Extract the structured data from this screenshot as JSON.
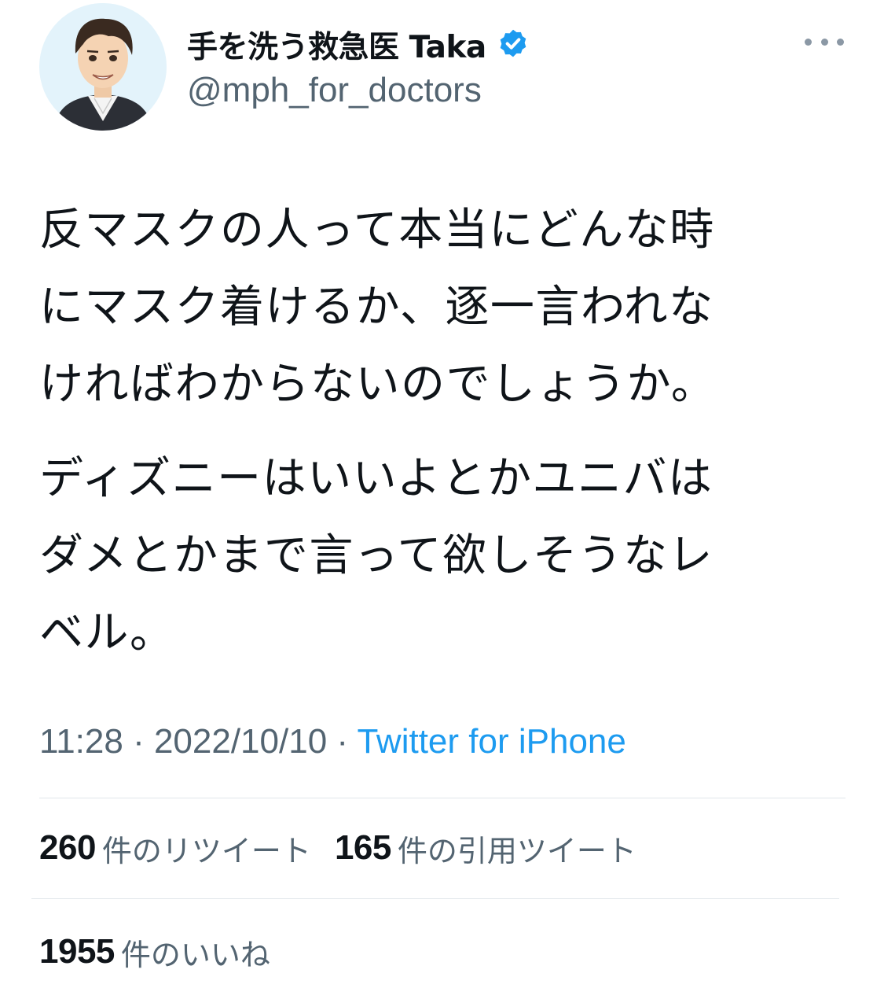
{
  "author": {
    "display_name": "手を洗う救急医 Taka",
    "handle": "@mph_for_doctors",
    "verified_icon": "verified-badge-icon",
    "avatar_icon": "doctor-avatar"
  },
  "tweet": {
    "paragraphs": [
      [
        "反マスクの人って本当にどんな時",
        "にマスク着けるか、逐一言われな",
        "ければわからないのでしょうか。"
      ],
      [
        "ディズニーはいいよとかユニバは",
        "ダメとかまで言って欲しそうなレ",
        "ベル。"
      ]
    ]
  },
  "meta": {
    "time": "11:28",
    "separator": " · ",
    "date": "2022/10/10",
    "source": "Twitter for iPhone"
  },
  "stats": {
    "retweets": {
      "count": "260",
      "label": "件のリツイート"
    },
    "quotes": {
      "count": "165",
      "label": "件の引用ツイート"
    },
    "likes": {
      "count": "1955",
      "label": "件のいいね"
    }
  },
  "colors": {
    "text_primary": "#0f1419",
    "text_secondary": "#536471",
    "link_blue": "#1d9bf0",
    "divider": "#e1e6ea"
  }
}
